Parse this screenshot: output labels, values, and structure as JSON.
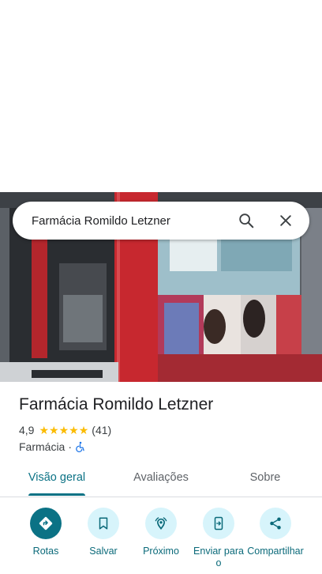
{
  "search": {
    "query": "Farmácia Romildo Letzner"
  },
  "place": {
    "name": "Farmácia Romildo Letzner",
    "rating": "4,9",
    "stars": 5,
    "review_count": "(41)",
    "category": "Farmácia",
    "separator": "·"
  },
  "tabs": [
    {
      "label": "Visão geral",
      "active": true
    },
    {
      "label": "Avaliações",
      "active": false
    },
    {
      "label": "Sobre",
      "active": false
    }
  ],
  "actions": [
    {
      "label": "Rotas",
      "icon": "directions-icon"
    },
    {
      "label": "Salvar",
      "icon": "bookmark-icon"
    },
    {
      "label": "Próximo",
      "icon": "nearby-icon"
    },
    {
      "label": "Enviar para o",
      "icon": "send-to-phone-icon"
    },
    {
      "label": "Compartilhar",
      "icon": "share-icon"
    }
  ],
  "colors": {
    "accent": "#0b7285",
    "action_bg": "#d7f4fb",
    "star": "#fbbc04"
  }
}
